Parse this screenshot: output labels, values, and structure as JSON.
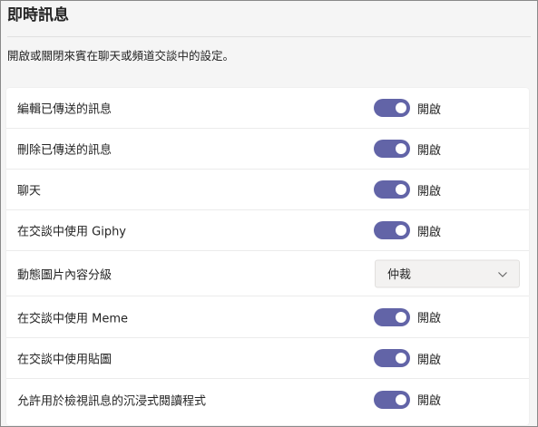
{
  "page": {
    "title": "即時訊息",
    "description": "開啟或關閉來賓在聊天或頻道交談中的設定。"
  },
  "colors": {
    "toggle_on": "#6264a7",
    "background": "#f5f5f5",
    "card": "#ffffff"
  },
  "settings": [
    {
      "label": "編輯已傳送的訊息",
      "state": "開啟"
    },
    {
      "label": "刪除已傳送的訊息",
      "state": "開啟"
    },
    {
      "label": "聊天",
      "state": "開啟"
    },
    {
      "label": "在交談中使用 Giphy",
      "state": "開啟"
    },
    {
      "label": "動態圖片內容分級",
      "selected": "仲裁"
    },
    {
      "label": "在交談中使用 Meme",
      "state": "開啟"
    },
    {
      "label": "在交談中使用貼圖",
      "state": "開啟"
    },
    {
      "label": "允許用於檢視訊息的沉浸式閱讀程式",
      "state": "開啟"
    }
  ]
}
